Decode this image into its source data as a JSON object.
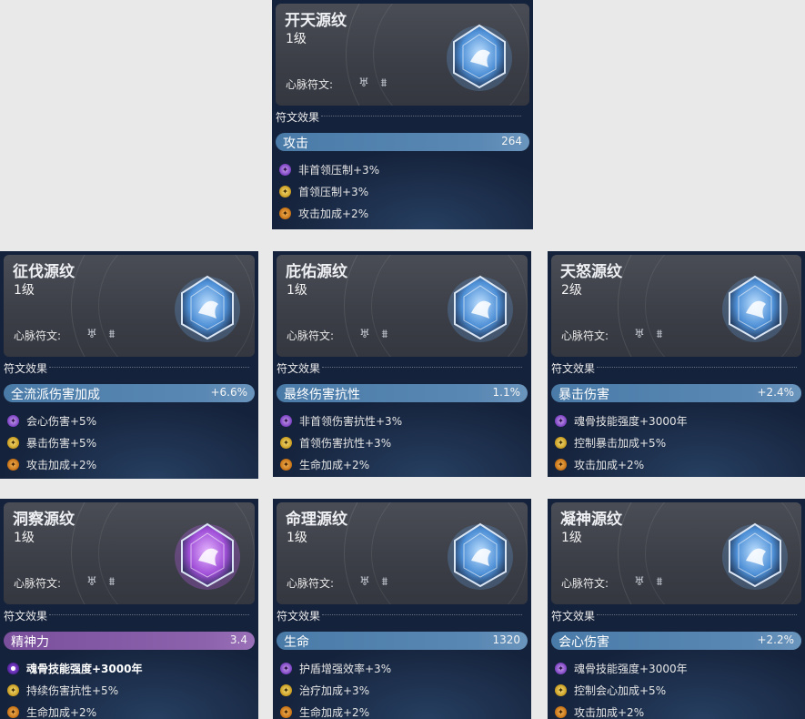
{
  "section_label": "符文效果",
  "heart_label": "心脉符文:",
  "cards": [
    {
      "id": "kaitian",
      "title": "开天源纹",
      "level": "1级",
      "theme": "blue",
      "stat": {
        "label": "攻击",
        "value": "264"
      },
      "effects": [
        {
          "text": "非首领压制+3%",
          "icon": "purple"
        },
        {
          "text": "首领压制+3%",
          "icon": "gold"
        },
        {
          "text": "攻击加成+2%",
          "icon": "orange"
        }
      ]
    },
    {
      "id": "zhengfa",
      "title": "征伐源纹",
      "level": "1级",
      "theme": "blue",
      "stat": {
        "label": "全流派伤害加成",
        "value": "+6.6%"
      },
      "effects": [
        {
          "text": "会心伤害+5%",
          "icon": "purple"
        },
        {
          "text": "暴击伤害+5%",
          "icon": "gold"
        },
        {
          "text": "攻击加成+2%",
          "icon": "orange"
        }
      ]
    },
    {
      "id": "biyou",
      "title": "庇佑源纹",
      "level": "1级",
      "theme": "blue",
      "stat": {
        "label": "最终伤害抗性",
        "value": "1.1%"
      },
      "effects": [
        {
          "text": "非首领伤害抗性+3%",
          "icon": "purple"
        },
        {
          "text": "首领伤害抗性+3%",
          "icon": "gold"
        },
        {
          "text": "生命加成+2%",
          "icon": "orange"
        }
      ]
    },
    {
      "id": "tiannu",
      "title": "天怒源纹",
      "level": "2级",
      "theme": "blue",
      "stat": {
        "label": "暴击伤害",
        "value": "+2.4%"
      },
      "effects": [
        {
          "text": "魂骨技能强度+3000年",
          "icon": "purple"
        },
        {
          "text": "控制暴击加成+5%",
          "icon": "gold"
        },
        {
          "text": "攻击加成+2%",
          "icon": "orange"
        }
      ]
    },
    {
      "id": "dongcha",
      "title": "洞察源纹",
      "level": "1级",
      "theme": "purple",
      "stat": {
        "label": "精神力",
        "value": "3.4"
      },
      "effects": [
        {
          "text": "魂骨技能强度+3000年",
          "icon": "violet",
          "bold": true
        },
        {
          "text": "持续伤害抗性+5%",
          "icon": "gold"
        },
        {
          "text": "生命加成+2%",
          "icon": "orange"
        }
      ]
    },
    {
      "id": "mingli",
      "title": "命理源纹",
      "level": "1级",
      "theme": "blue",
      "stat": {
        "label": "生命",
        "value": "1320"
      },
      "effects": [
        {
          "text": "护盾增强效率+3%",
          "icon": "purple"
        },
        {
          "text": "治疗加成+3%",
          "icon": "gold"
        },
        {
          "text": "生命加成+2%",
          "icon": "orange"
        }
      ]
    },
    {
      "id": "ningshen",
      "title": "凝神源纹",
      "level": "1级",
      "theme": "blue",
      "stat": {
        "label": "会心伤害",
        "value": "+2.2%"
      },
      "effects": [
        {
          "text": "魂骨技能强度+3000年",
          "icon": "purple"
        },
        {
          "text": "控制会心加成+5%",
          "icon": "gold"
        },
        {
          "text": "攻击加成+2%",
          "icon": "orange"
        }
      ]
    }
  ]
}
